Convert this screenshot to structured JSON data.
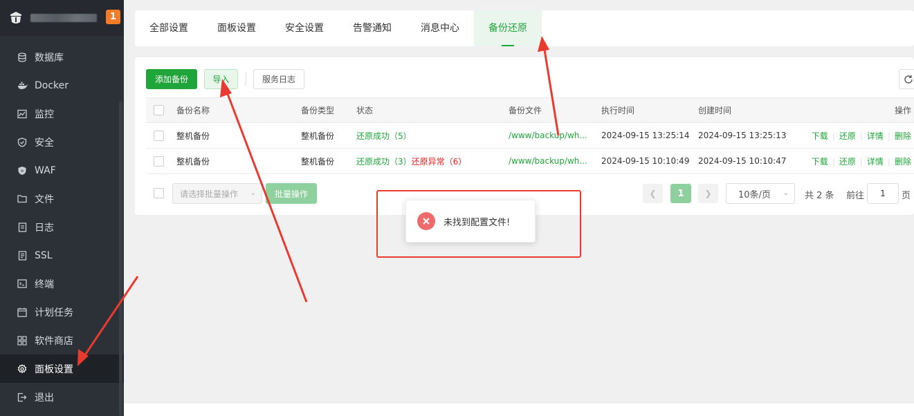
{
  "sidebar": {
    "badge": "1",
    "items": [
      {
        "label": "数据库",
        "icon": "database-icon"
      },
      {
        "label": "Docker",
        "icon": "docker-icon"
      },
      {
        "label": "监控",
        "icon": "monitor-icon"
      },
      {
        "label": "安全",
        "icon": "shield-icon"
      },
      {
        "label": "WAF",
        "icon": "waf-icon"
      },
      {
        "label": "文件",
        "icon": "folder-icon"
      },
      {
        "label": "日志",
        "icon": "log-icon"
      },
      {
        "label": "SSL",
        "icon": "ssl-icon"
      },
      {
        "label": "终端",
        "icon": "terminal-icon"
      },
      {
        "label": "计划任务",
        "icon": "calendar-icon"
      },
      {
        "label": "软件商店",
        "icon": "apps-icon"
      },
      {
        "label": "面板设置",
        "icon": "gear-icon"
      },
      {
        "label": "退出",
        "icon": "logout-icon"
      }
    ],
    "active_index": 11
  },
  "tabs": [
    "全部设置",
    "面板设置",
    "安全设置",
    "告警通知",
    "消息中心",
    "备份还原"
  ],
  "active_tab_index": 5,
  "toolbar": {
    "add_backup": "添加备份",
    "import": "导入",
    "service_log": "服务日志"
  },
  "table": {
    "headers": [
      "备份名称",
      "备份类型",
      "状态",
      "备份文件",
      "执行时间",
      "创建时间",
      "操作"
    ],
    "rows": [
      {
        "name": "整机备份",
        "type": "整机备份",
        "status_ok": "还原成功（5）",
        "status_err": "",
        "file": "/www/backup/wh...",
        "exec_time": "2024-09-15 13:25:14",
        "create_time": "2024-09-15 13:25:13"
      },
      {
        "name": "整机备份",
        "type": "整机备份",
        "status_ok": "还原成功（3）",
        "status_err": "还原异常（6）",
        "file": "/www/backup/wh...",
        "exec_time": "2024-09-15 10:10:49",
        "create_time": "2024-09-15 10:10:47"
      }
    ],
    "actions": [
      "下载",
      "还原",
      "详情",
      "删除"
    ]
  },
  "batch": {
    "placeholder": "请选择批量操作",
    "button": "批量操作"
  },
  "pagination": {
    "current": "1",
    "page_size": "10条/页",
    "total": "共 2 条",
    "goto": "前往",
    "goto_value": "1",
    "page_suffix": "页"
  },
  "toast": {
    "message": "未找到配置文件!"
  },
  "colors": {
    "brand": "#20a53a",
    "sidebar_bg": "#2c3138",
    "error": "#e02020",
    "annotation": "#e83a2e"
  }
}
